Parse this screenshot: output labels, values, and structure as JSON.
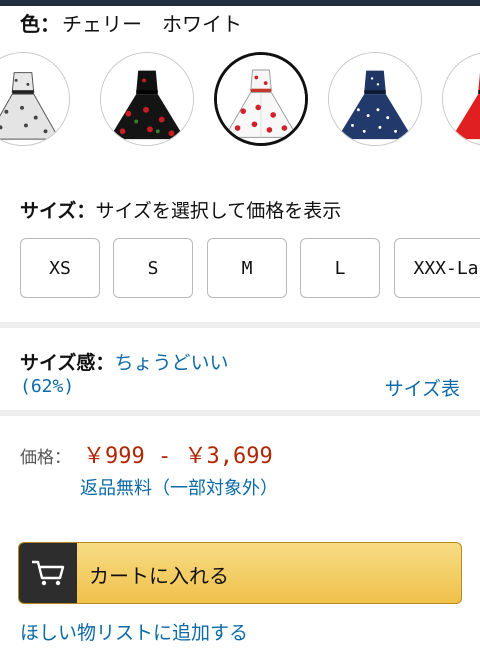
{
  "color": {
    "label": "色：",
    "value": "チェリー　ホワイト"
  },
  "swatches": [
    {
      "name": "white-floral-dress",
      "selected": false
    },
    {
      "name": "black-cherry-dress",
      "selected": false
    },
    {
      "name": "white-cherry-dress",
      "selected": true
    },
    {
      "name": "navy-polka-dot-dress",
      "selected": false
    },
    {
      "name": "red-dress",
      "selected": false
    }
  ],
  "size": {
    "label": "サイズ：",
    "prompt": "サイズを選択して価格を表示",
    "options": [
      "XS",
      "S",
      "M",
      "L",
      "XXX-La"
    ]
  },
  "fit": {
    "label": "サイズ感：",
    "value": "ちょうどいい",
    "percent": "(62%)",
    "chart_link": "サイズ表"
  },
  "price": {
    "label": "価格：",
    "range": "￥999 - ￥3,699",
    "returns": "返品無料（一部対象外）"
  },
  "cart": {
    "label": "カートに入れる",
    "icon": "cart-icon"
  },
  "wishlist": {
    "label": "ほしい物リストに追加する"
  },
  "colors": {
    "link": "#0c6aa6",
    "price": "#b12704",
    "button": "#f0c14b"
  }
}
